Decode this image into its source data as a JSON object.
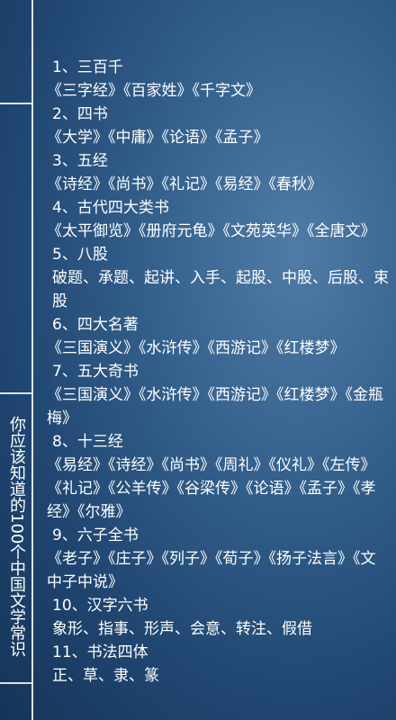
{
  "side_title": "你应该知道的100个中国文学常识",
  "sections": [
    {
      "title": "1、三百千",
      "body": "《三字经》《百家姓》《千字文》",
      "indent": false
    },
    {
      "title": "2、四书",
      "body": "《大学》《中庸》《论语》《孟子》",
      "indent": false
    },
    {
      "title": "3、五经",
      "body": "《诗经》《尚书》《礼记》《易经》《春秋》",
      "indent": false
    },
    {
      "title": "4、古代四大类书",
      "body": "《太平御览》《册府元龟》《文苑英华》《全唐文》",
      "indent": false
    },
    {
      "title": "5、八股",
      "body": "破题、承题、起讲、入手、起股、中股、后股、束股",
      "indent": true
    },
    {
      "title": "6、四大名著",
      "body": "《三国演义》《水浒传》《西游记》《红楼梦》",
      "indent": false
    },
    {
      "title": "7、五大奇书",
      "body": "《三国演义》《水浒传》《西游记》《红楼梦》《金瓶梅》",
      "indent": false
    },
    {
      "title": "8、十三经",
      "body": "《易经》《诗经》《尚书》《周礼》《仪礼》《左传》《礼记》《公羊传》《谷梁传》《论语》《孟子》《孝经》《尔雅》",
      "indent": false
    },
    {
      "title": "9、六子全书",
      "body": "《老子》《庄子》《列子》《荀子》《扬子法言》《文中子中说》",
      "indent": false
    },
    {
      "title": "10、汉字六书",
      "body": "象形、指事、形声、会意、转注、假借",
      "indent": true
    },
    {
      "title": "11、书法四体",
      "body": "正、草、隶、篆",
      "indent": true
    }
  ]
}
